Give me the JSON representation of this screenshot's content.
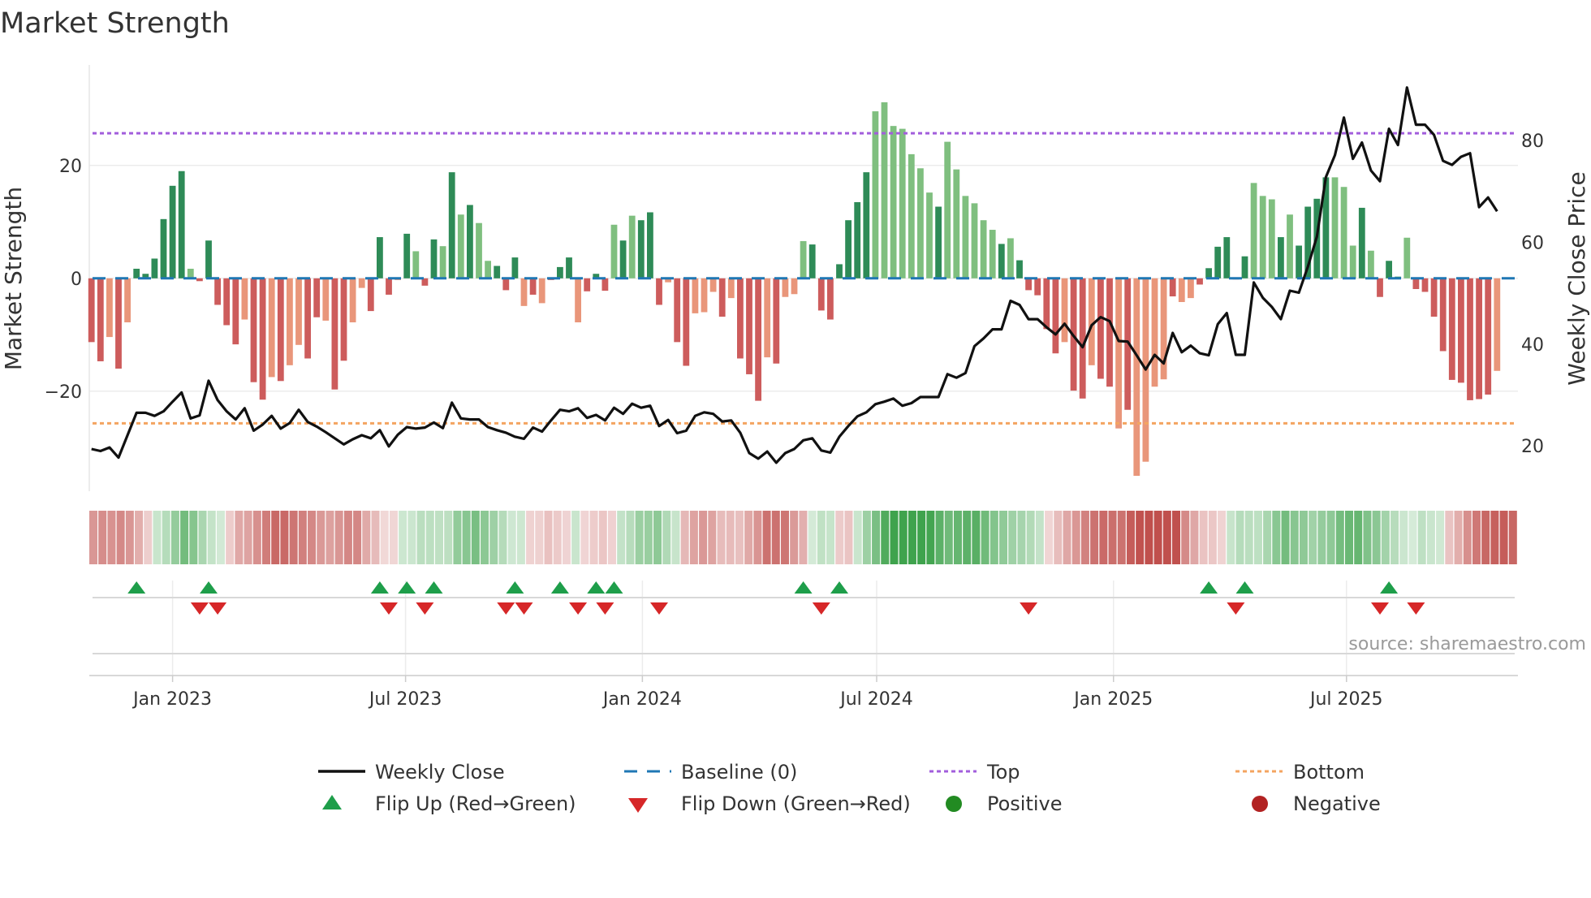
{
  "title": "Market Strength",
  "source": "source: sharemaestro.com",
  "legend": {
    "weekly_close": "Weekly Close",
    "baseline": "Baseline (0)",
    "top": "Top",
    "bottom": "Bottom",
    "flip_up": "Flip Up (Red→Green)",
    "flip_down": "Flip Down (Green→Red)",
    "positive": "Positive",
    "negative": "Negative"
  },
  "colors": {
    "pos_dark": "#2e8b57",
    "pos_light": "#7fbf7f",
    "neg_dark": "#cd5c5c",
    "neg_light": "#e9967a",
    "baseline": "#1f77b4",
    "top": "#a25ddc",
    "bottom": "#f4a460",
    "line": "#111111",
    "flip_up": "#1e9e4a",
    "flip_down": "#d62728",
    "positive_dot": "#228b22",
    "negative_dot": "#b22222"
  },
  "chart_data": {
    "type": "bar",
    "title": "Market Strength",
    "ylabel": "Market Strength",
    "y2label": "Weekly Close Price",
    "x_start": "2022-10-30",
    "x_step_days": 7,
    "ylim": [
      -38,
      38
    ],
    "y2lim": [
      6,
      99
    ],
    "yticks": [
      {
        "v": 20,
        "label": "20"
      },
      {
        "v": 0,
        "label": "0"
      },
      {
        "v": -20,
        "label": "−20"
      }
    ],
    "y2ticks": [
      {
        "v": 80,
        "label": "80"
      },
      {
        "v": 60,
        "label": "60"
      },
      {
        "v": 40,
        "label": "40"
      },
      {
        "v": 20,
        "label": "20"
      }
    ],
    "xticks": [
      {
        "date": "2023-01-01",
        "label": "Jan 2023"
      },
      {
        "date": "2023-07-01",
        "label": "Jul 2023"
      },
      {
        "date": "2024-01-01",
        "label": "Jan 2024"
      },
      {
        "date": "2024-07-01",
        "label": "Jul 2024"
      },
      {
        "date": "2025-01-01",
        "label": "Jan 2025"
      },
      {
        "date": "2025-07-01",
        "label": "Jul 2025"
      }
    ],
    "top_level": 25.7,
    "bottom_level": -25.7,
    "baseline": 0,
    "strength": [
      -11.3,
      -14.7,
      -10.4,
      -16,
      -7.8,
      1.7,
      0.8,
      3.5,
      10.5,
      16.4,
      19,
      1.7,
      -0.5,
      6.7,
      -4.7,
      -8.3,
      -11.7,
      -7.3,
      -18.4,
      -21.5,
      -17.5,
      -18.2,
      -15.4,
      -11.8,
      -14.2,
      -6.9,
      -7.5,
      -19.7,
      -14.6,
      -7.8,
      -1.7,
      -5.8,
      7.3,
      -2.9,
      -0.3,
      7.9,
      4.8,
      -1.3,
      6.9,
      5.7,
      18.8,
      11.3,
      13,
      9.8,
      3.1,
      2.2,
      -2.1,
      3.7,
      -4.9,
      -2.9,
      -4.4,
      -0.3,
      2,
      3.7,
      -7.8,
      -2.3,
      0.8,
      -2.2,
      9.5,
      6.7,
      11.1,
      10.3,
      11.7,
      -4.7,
      -0.7,
      -11.3,
      -15.5,
      -6.2,
      -6,
      -2.4,
      -6.8,
      -3.5,
      -14.2,
      -17,
      -21.7,
      -14,
      -15.1,
      -3.3,
      -2.8,
      6.6,
      6,
      -5.7,
      -7.3,
      2.5,
      10.3,
      13.5,
      18.8,
      29.6,
      31.2,
      27,
      26.5,
      22,
      19.5,
      15.2,
      12.7,
      24.2,
      19.3,
      14.6,
      13.3,
      10.3,
      8.6,
      6.1,
      7.1,
      3.2,
      -2.1,
      -3,
      -9,
      -13.3,
      -11.3,
      -19.9,
      -21.3,
      -15.4,
      -17.8,
      -19.2,
      -26.6,
      -23.3,
      -35,
      -32.5,
      -19.2,
      -17.9,
      -3.2,
      -4.2,
      -3.5,
      -1.1,
      1.8,
      5.6,
      7.3,
      -0.2,
      3.9,
      16.9,
      14.6,
      14,
      7.3,
      11.3,
      5.8,
      12.7,
      14.1,
      17.9,
      17.9,
      16.2,
      5.8,
      12.5,
      4.9,
      -3.3,
      3.1,
      0.3,
      7.2,
      -1.9,
      -2.4,
      -6.8,
      -12.9,
      -18,
      -18.5,
      -21.6,
      -21.4,
      -20.6,
      -16.4
    ],
    "shade": "ddldlddddddldddddlddldllddlddlldddldlddldldlldddldldddldddldldddlddllldldddldllldddddddllllllldlllllldldddddlddlddldlllldllddddddllldlddddllldldddldddddddddlll",
    "weekly_close": [
      19.4,
      19.0,
      19.7,
      17.7,
      22.1,
      26.5,
      26.5,
      25.9,
      26.8,
      28.7,
      30.5,
      25.4,
      26.0,
      32.8,
      29.0,
      26.8,
      25.2,
      27.4,
      23.0,
      24.2,
      25.9,
      23.4,
      24.5,
      27.1,
      24.7,
      23.8,
      22.7,
      21.5,
      20.3,
      21.3,
      22.1,
      21.5,
      23.1,
      19.9,
      22.2,
      23.7,
      23.4,
      23.6,
      24.6,
      23.5,
      28.5,
      25.4,
      25.2,
      25.2,
      23.7,
      23.1,
      22.6,
      21.8,
      21.4,
      23.6,
      22.8,
      25.0,
      27.1,
      26.8,
      27.4,
      25.5,
      26.1,
      25.0,
      27.5,
      26.3,
      28.3,
      27.5,
      27.9,
      23.9,
      25.1,
      22.5,
      23.0,
      25.9,
      26.6,
      26.3,
      24.8,
      25.0,
      22.6,
      18.6,
      17.5,
      18.9,
      16.7,
      18.6,
      19.4,
      21.1,
      21.5,
      19.1,
      18.7,
      21.8,
      23.9,
      25.8,
      26.6,
      28.2,
      28.7,
      29.3,
      27.9,
      28.4,
      29.6,
      29.6,
      29.6,
      34.1,
      33.4,
      34.3,
      39.6,
      41.1,
      42.9,
      42.9,
      48.5,
      47.7,
      44.9,
      44.9,
      43.3,
      41.9,
      44.0,
      41.6,
      39.4,
      43.7,
      45.3,
      44.5,
      40.6,
      40.5,
      37.8,
      35.0,
      37.9,
      36.2,
      42.2,
      38.4,
      39.7,
      38.2,
      37.8,
      43.9,
      46.1,
      37.9,
      37.9,
      52.1,
      49.1,
      47.3,
      44.9,
      50.5,
      50.1,
      55.2,
      61.1,
      72.8,
      77.1,
      84.5,
      76.4,
      79.6,
      74.1,
      72.0,
      82.3,
      79.1,
      90.4,
      83.1,
      83.1,
      81.1,
      76.0,
      75.2,
      76.8,
      77.5,
      66.9,
      68.8,
      66.1
    ],
    "flip_up_weeks": [
      6,
      14,
      33,
      36,
      39,
      48,
      53,
      57,
      59,
      80,
      84,
      125,
      129,
      145
    ],
    "flip_down_weeks": [
      13,
      15,
      34,
      38,
      47,
      49,
      55,
      58,
      64,
      82,
      105,
      128,
      144,
      148
    ]
  }
}
